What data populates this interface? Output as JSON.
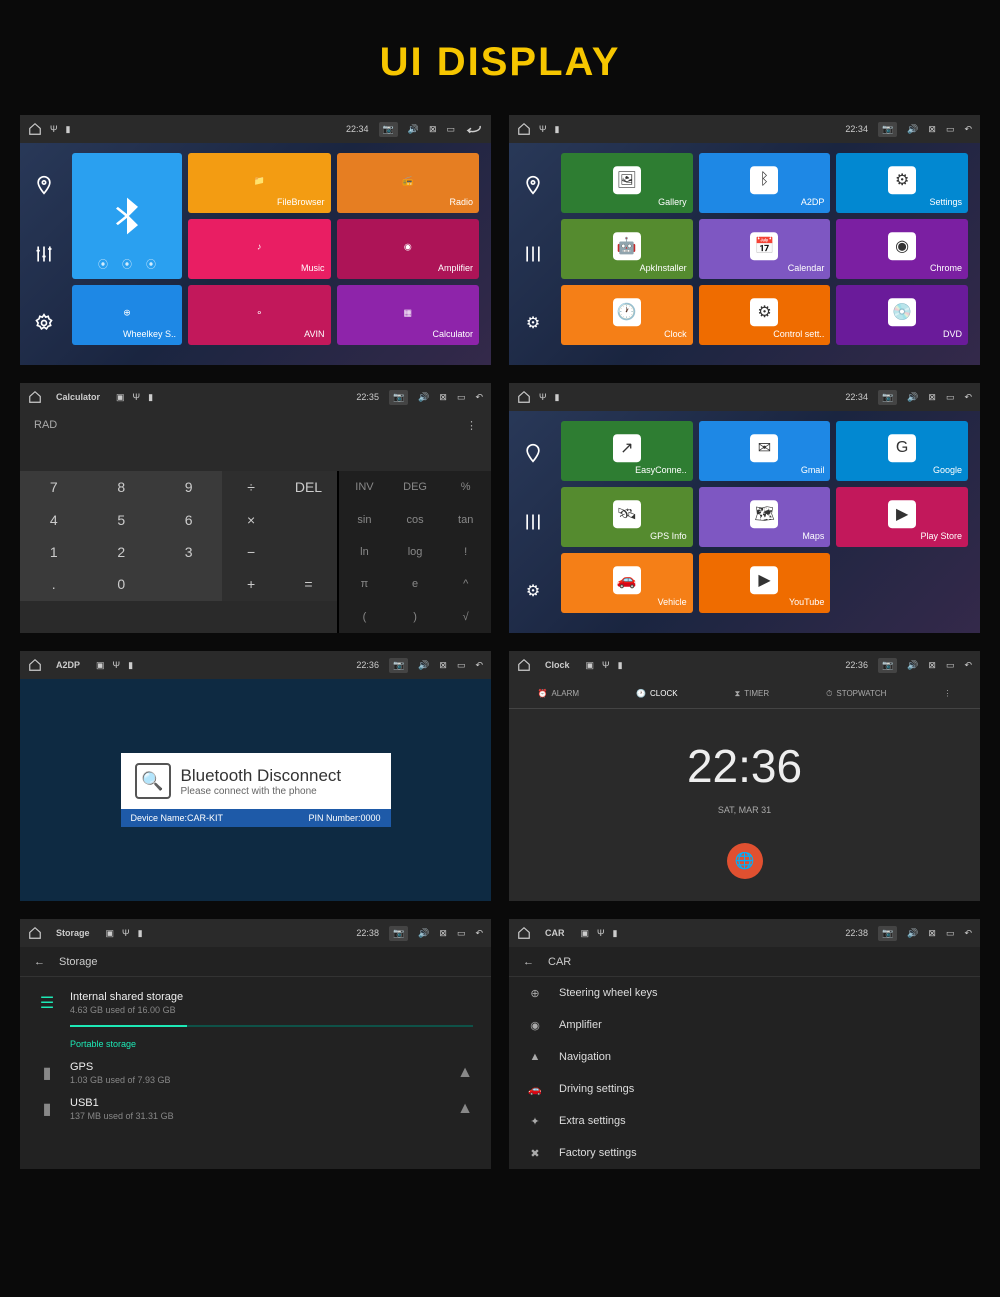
{
  "page_title": "UI DISPLAY",
  "times": {
    "t1": "22:34",
    "t2": "22:35",
    "t3": "22:36",
    "t4": "22:38"
  },
  "home1": {
    "big": {
      "bg": "#2aa0f0"
    },
    "wheel": {
      "label": "Wheelkey S..",
      "bg": "#1e88e5"
    },
    "tiles": [
      {
        "label": "FileBrowser",
        "bg": "#f39c12"
      },
      {
        "label": "Radio",
        "bg": "#e67e22"
      },
      {
        "label": "Music",
        "bg": "#e91e63"
      },
      {
        "label": "Amplifier",
        "bg": "#ad1457"
      },
      {
        "label": "AVIN",
        "bg": "#c2185b"
      },
      {
        "label": "Calculator",
        "bg": "#8e24aa"
      }
    ]
  },
  "home2": {
    "tiles": [
      {
        "label": "Gallery",
        "bg": "#2e7d32"
      },
      {
        "label": "A2DP",
        "bg": "#1e88e5"
      },
      {
        "label": "Settings",
        "bg": "#0288d1"
      },
      {
        "label": "ApkInstaller",
        "bg": "#558b2f"
      },
      {
        "label": "Calendar",
        "bg": "#7e57c2"
      },
      {
        "label": "Chrome",
        "bg": "#7b1fa2"
      },
      {
        "label": "Clock",
        "bg": "#f57f17"
      },
      {
        "label": "Control sett..",
        "bg": "#ef6c00"
      },
      {
        "label": "DVD",
        "bg": "#6a1b9a"
      }
    ]
  },
  "home3": {
    "tiles": [
      {
        "label": "EasyConne..",
        "bg": "#2e7d32"
      },
      {
        "label": "Gmail",
        "bg": "#1e88e5"
      },
      {
        "label": "Google",
        "bg": "#0288d1"
      },
      {
        "label": "GPS Info",
        "bg": "#558b2f"
      },
      {
        "label": "Maps",
        "bg": "#7e57c2"
      },
      {
        "label": "Play Store",
        "bg": "#c2185b"
      },
      {
        "label": "Vehicle",
        "bg": "#f57f17"
      },
      {
        "label": "YouTube",
        "bg": "#ef6c00"
      }
    ]
  },
  "calc": {
    "title": "Calculator",
    "mode": "RAD",
    "rows": [
      [
        "7",
        "8",
        "9",
        "÷",
        "",
        "INV",
        "DEG",
        "%"
      ],
      [
        "4",
        "5",
        "6",
        "×",
        "",
        "sin",
        "cos",
        "tan"
      ],
      [
        "1",
        "2",
        "3",
        "−",
        "",
        "ln",
        "log",
        "!"
      ],
      [
        ".",
        "0",
        " ",
        "+",
        "",
        "π",
        "e",
        "^"
      ],
      [
        "",
        " ",
        "DEL",
        "=",
        "",
        "(",
        ")",
        "√"
      ]
    ]
  },
  "a2dp": {
    "title": "A2DP",
    "h": "Bluetooth Disconnect",
    "sub": "Please connect with the phone",
    "dev_l": "Device Name:CAR-KIT",
    "dev_r": "PIN Number:0000"
  },
  "clock": {
    "title": "Clock",
    "tabs": [
      "ALARM",
      "CLOCK",
      "TIMER",
      "STOPWATCH"
    ],
    "time": "22:36",
    "date": "SAT, MAR 31"
  },
  "storage": {
    "title": "Storage",
    "header": "Storage",
    "internal": {
      "t": "Internal shared storage",
      "s": "4.63 GB used of 16.00 GB",
      "pct": 29
    },
    "section": "Portable storage",
    "gps": {
      "t": "GPS",
      "s": "1.03 GB used of 7.93 GB"
    },
    "usb": {
      "t": "USB1",
      "s": "137 MB used of 31.31 GB"
    }
  },
  "car": {
    "title": "CAR",
    "header": "CAR",
    "items": [
      {
        "icon": "wheel",
        "t": "Steering wheel keys"
      },
      {
        "icon": "amp",
        "t": "Amplifier"
      },
      {
        "icon": "nav",
        "t": "Navigation"
      },
      {
        "icon": "drive",
        "t": "Driving settings"
      },
      {
        "icon": "extra",
        "t": "Extra settings"
      },
      {
        "icon": "factory",
        "t": "Factory settings"
      }
    ]
  }
}
